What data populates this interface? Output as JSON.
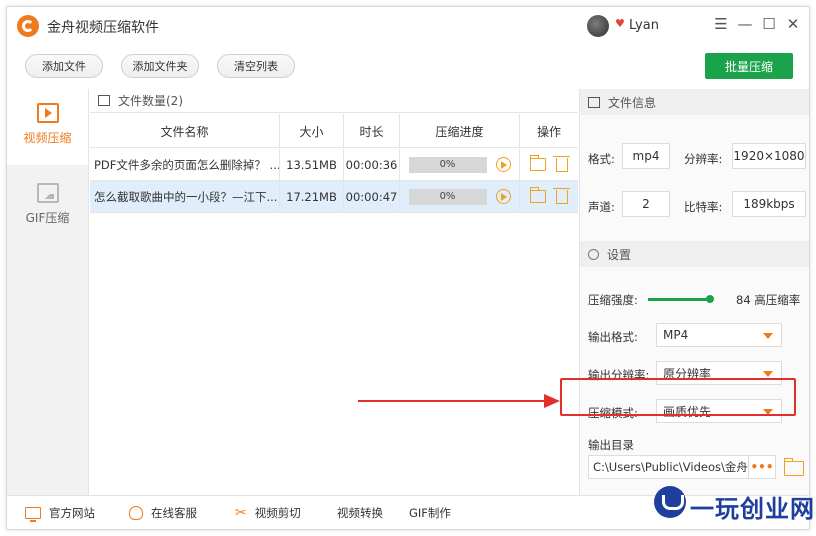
{
  "app": {
    "title": "金舟视频压缩软件",
    "username": "Lyan"
  },
  "window_controls": {
    "menu": "☰",
    "minimize": "—",
    "maximize": "☐",
    "close": "✕"
  },
  "toolbar": {
    "add_file": "添加文件",
    "add_folder": "添加文件夹",
    "clear_list": "清空列表",
    "batch_compress": "批量压缩"
  },
  "sidebar": {
    "items": [
      {
        "label": "视频压缩",
        "icon": "video-play-icon",
        "active": true
      },
      {
        "label": "GIF压缩",
        "icon": "image-icon",
        "active": false
      }
    ]
  },
  "file_list": {
    "count_label": "文件数量(2)",
    "columns": [
      "文件名称",
      "大小",
      "时长",
      "压缩进度",
      "操作"
    ],
    "rows": [
      {
        "name": "PDF文件多余的页面怎么删除掉？ ...",
        "size": "13.51MB",
        "duration": "00:00:36",
        "progress": "0%",
        "progress_value": 0,
        "selected": false
      },
      {
        "name": "怎么截取歌曲中的一小段？—江下...",
        "size": "17.21MB",
        "duration": "00:00:47",
        "progress": "0%",
        "progress_value": 0,
        "selected": true
      }
    ]
  },
  "file_info": {
    "header": "文件信息",
    "format_label": "格式:",
    "format_value": "mp4",
    "resolution_label": "分辨率:",
    "resolution_value": "1920×1080",
    "channel_label": "声道:",
    "channel_value": "2",
    "bitrate_label": "比特率:",
    "bitrate_value": "189kbps"
  },
  "settings": {
    "header": "设置",
    "strength_label": "压缩强度:",
    "strength_value": "84 高压缩率",
    "strength_level": 84,
    "output_format_label": "输出格式:",
    "output_format_value": "MP4",
    "output_resolution_label": "输出分辨率:",
    "output_resolution_value": "原分辨率",
    "compress_mode_label": "压缩模式:",
    "compress_mode_value": "画质优先",
    "output_dir_label": "输出目录",
    "output_dir_value": "C:\\Users\\Public\\Videos\\金舟视",
    "browse_label": "•••"
  },
  "bottom_bar": {
    "official_site": "官方网站",
    "online_service": "在线客服",
    "video_cut": "视频剪切",
    "video_convert": "视频转换",
    "gif_make": "GIF制作"
  },
  "watermark": {
    "text": "一玩创业网"
  },
  "colors": {
    "accent": "#f07a1e",
    "primary_green": "#1aa34a",
    "highlight_red": "#e0302a",
    "selected_row": "#dfeefa"
  }
}
